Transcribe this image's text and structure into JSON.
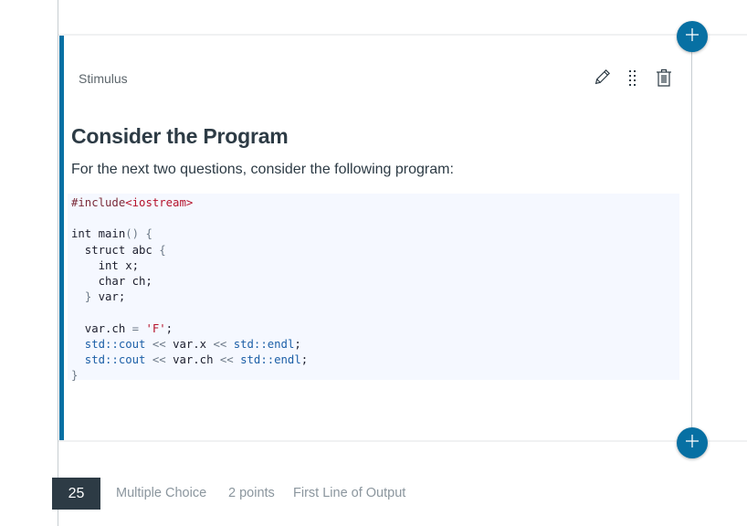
{
  "stimulus_card": {
    "label": "Stimulus",
    "title": "Consider the Program",
    "intro": "For the next two questions, consider the following program:",
    "toolbar": {
      "edit_icon": "pencil-icon",
      "drag_icon": "drag-handle-icon",
      "delete_icon": "trash-icon"
    },
    "code_lines": [
      {
        "tokens": [
          {
            "t": "#include",
            "c": "pre"
          },
          {
            "t": "<iostream>",
            "c": "str"
          }
        ]
      },
      {
        "tokens": [
          {
            "t": "",
            "c": "kw"
          }
        ]
      },
      {
        "tokens": [
          {
            "t": "int main",
            "c": "kw"
          },
          {
            "t": "() {",
            "c": "op"
          }
        ]
      },
      {
        "tokens": [
          {
            "t": "  struct abc ",
            "c": "kw"
          },
          {
            "t": "{",
            "c": "op"
          }
        ]
      },
      {
        "tokens": [
          {
            "t": "    int x;",
            "c": "kw"
          }
        ]
      },
      {
        "tokens": [
          {
            "t": "    char ch;",
            "c": "kw"
          }
        ]
      },
      {
        "tokens": [
          {
            "t": "  ",
            "c": "kw"
          },
          {
            "t": "}",
            "c": "op"
          },
          {
            "t": " var;",
            "c": "kw"
          }
        ]
      },
      {
        "tokens": [
          {
            "t": "",
            "c": "kw"
          }
        ]
      },
      {
        "tokens": [
          {
            "t": "  var.ch ",
            "c": "kw"
          },
          {
            "t": "=",
            "c": "op"
          },
          {
            "t": " ",
            "c": "kw"
          },
          {
            "t": "'F'",
            "c": "ch"
          },
          {
            "t": ";",
            "c": "kw"
          }
        ]
      },
      {
        "tokens": [
          {
            "t": "  std::cout",
            "c": "fn"
          },
          {
            "t": " << ",
            "c": "op"
          },
          {
            "t": "var.x",
            "c": "kw"
          },
          {
            "t": " << ",
            "c": "op"
          },
          {
            "t": "std::endl",
            "c": "fn"
          },
          {
            "t": ";",
            "c": "kw"
          }
        ]
      },
      {
        "tokens": [
          {
            "t": "  std::cout",
            "c": "fn"
          },
          {
            "t": " << ",
            "c": "op"
          },
          {
            "t": "var.ch",
            "c": "kw"
          },
          {
            "t": " << ",
            "c": "op"
          },
          {
            "t": "std::endl",
            "c": "fn"
          },
          {
            "t": ";",
            "c": "kw"
          }
        ]
      },
      {
        "tokens": [
          {
            "t": "}",
            "c": "op"
          }
        ]
      }
    ]
  },
  "add_buttons": {
    "icon": "plus-icon"
  },
  "next_question": {
    "number": "25",
    "type": "Multiple Choice",
    "points": "2 points",
    "title": "First Line of Output"
  },
  "colors": {
    "accent": "#0770a3",
    "heading": "#2d3b45",
    "muted": "#8b969e",
    "code_bg": "#f5f8ff"
  }
}
